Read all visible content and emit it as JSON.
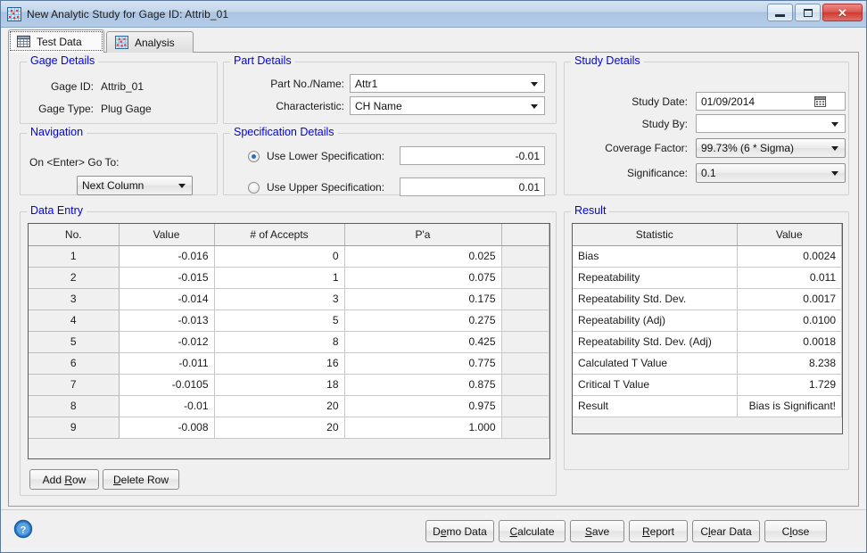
{
  "window": {
    "title": "New Analytic Study for Gage ID:  Attrib_01",
    "icon": "scatter-plot-icon",
    "controls": {
      "minimize": "minimize",
      "maximize": "maximize",
      "close": "close"
    }
  },
  "tabs": [
    {
      "label": "Test Data",
      "icon": "grid-table-icon",
      "active": true
    },
    {
      "label": "Analysis",
      "icon": "scatter-plot-icon",
      "active": false
    }
  ],
  "gage_details": {
    "legend": "Gage Details",
    "gage_id_label": "Gage ID:",
    "gage_id_value": "Attrib_01",
    "gage_type_label": "Gage Type:",
    "gage_type_value": "Plug Gage"
  },
  "part_details": {
    "legend": "Part Details",
    "part_no_label": "Part No./Name:",
    "part_no_value": "Attr1",
    "characteristic_label": "Characteristic:",
    "characteristic_value": "CH Name"
  },
  "study_details": {
    "legend": "Study Details",
    "study_date_label": "Study Date:",
    "study_date_value": "01/09/2014",
    "study_by_label": "Study By:",
    "study_by_value": "",
    "coverage_factor_label": "Coverage Factor:",
    "coverage_factor_value": "99.73% (6 * Sigma)",
    "significance_label": "Significance:",
    "significance_value": "0.1"
  },
  "navigation": {
    "legend": "Navigation",
    "on_enter_label": "On <Enter> Go To:",
    "on_enter_value": "Next Column"
  },
  "specification_details": {
    "legend": "Specification Details",
    "lower_label": "Use Lower Specification:",
    "lower_value": "-0.01",
    "lower_selected": true,
    "upper_label": "Use Upper Specification:",
    "upper_value": "0.01",
    "upper_selected": false
  },
  "data_entry": {
    "legend": "Data Entry",
    "columns": [
      "No.",
      "Value",
      "# of Accepts",
      "P'a"
    ],
    "rows": [
      {
        "no": "1",
        "value": "-0.016",
        "accepts": "0",
        "pa": "0.025"
      },
      {
        "no": "2",
        "value": "-0.015",
        "accepts": "1",
        "pa": "0.075"
      },
      {
        "no": "3",
        "value": "-0.014",
        "accepts": "3",
        "pa": "0.175"
      },
      {
        "no": "4",
        "value": "-0.013",
        "accepts": "5",
        "pa": "0.275"
      },
      {
        "no": "5",
        "value": "-0.012",
        "accepts": "8",
        "pa": "0.425"
      },
      {
        "no": "6",
        "value": "-0.011",
        "accepts": "16",
        "pa": "0.775"
      },
      {
        "no": "7",
        "value": "-0.0105",
        "accepts": "18",
        "pa": "0.875"
      },
      {
        "no": "8",
        "value": "-0.01",
        "accepts": "20",
        "pa": "0.975"
      },
      {
        "no": "9",
        "value": "-0.008",
        "accepts": "20",
        "pa": "1.000"
      }
    ],
    "add_row_button": {
      "pre": "Add ",
      "mnemonic": "R",
      "post": "ow"
    },
    "delete_row_button": {
      "pre": "",
      "mnemonic": "D",
      "post": "elete Row"
    }
  },
  "result": {
    "legend": "Result",
    "columns": [
      "Statistic",
      "Value"
    ],
    "rows": [
      {
        "statistic": "Bias",
        "value": "0.0024"
      },
      {
        "statistic": "Repeatability",
        "value": "0.011"
      },
      {
        "statistic": "Repeatability Std. Dev.",
        "value": "0.0017"
      },
      {
        "statistic": "Repeatability (Adj)",
        "value": "0.0100"
      },
      {
        "statistic": "Repeatability Std. Dev. (Adj)",
        "value": "0.0018"
      },
      {
        "statistic": "Calculated T Value",
        "value": "8.238"
      },
      {
        "statistic": "Critical T Value",
        "value": "1.729"
      },
      {
        "statistic": "Result",
        "value": "Bias is Significant!"
      }
    ]
  },
  "footer": {
    "help_icon": "help-circle-icon",
    "buttons": [
      {
        "pre": "D",
        "mnemonic": "e",
        "post": "mo Data"
      },
      {
        "pre": "",
        "mnemonic": "C",
        "post": "alculate"
      },
      {
        "pre": "",
        "mnemonic": "S",
        "post": "ave"
      },
      {
        "pre": "",
        "mnemonic": "R",
        "post": "eport"
      },
      {
        "pre": "C",
        "mnemonic": "l",
        "post": "ear Data"
      },
      {
        "pre": "C",
        "mnemonic": "l",
        "post": "ose"
      }
    ]
  },
  "colors": {
    "legend_blue": "#0000ee",
    "titlebar_blue": "#b5cce7",
    "accent_radio": "#2b6fbf",
    "window_bg": "#f0f0f0"
  }
}
